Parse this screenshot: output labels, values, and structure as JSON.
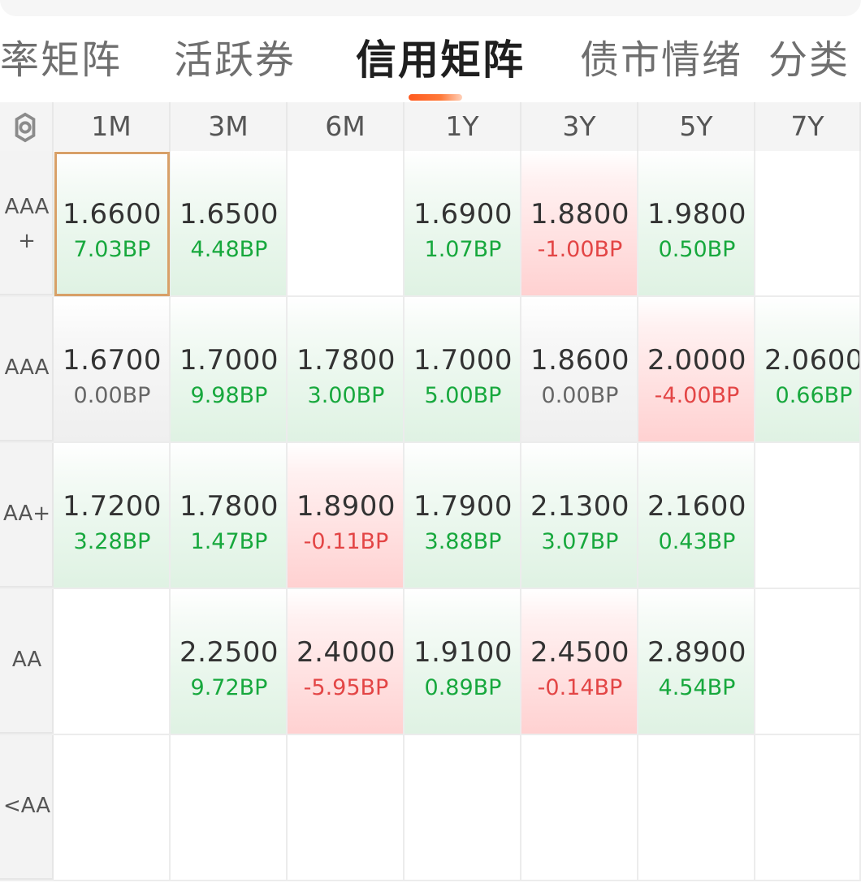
{
  "tabs": {
    "items": [
      {
        "label": "率矩阵"
      },
      {
        "label": "活跃券"
      },
      {
        "label": "信用矩阵"
      },
      {
        "label": "债市情绪"
      },
      {
        "label": "分类"
      }
    ],
    "active_index": 2
  },
  "matrix": {
    "columns": [
      "1M",
      "3M",
      "6M",
      "1Y",
      "3Y",
      "5Y",
      "7Y"
    ],
    "rows": [
      {
        "label": "AAA\n+",
        "cells": [
          {
            "value": "1.6600",
            "bp": "7.03BP",
            "tone": "green",
            "selected": true
          },
          {
            "value": "1.6500",
            "bp": "4.48BP",
            "tone": "green"
          },
          {
            "value": "",
            "bp": "",
            "tone": "empty"
          },
          {
            "value": "1.6900",
            "bp": "1.07BP",
            "tone": "green"
          },
          {
            "value": "1.8800",
            "bp": "-1.00BP",
            "tone": "red"
          },
          {
            "value": "1.9800",
            "bp": "0.50BP",
            "tone": "green"
          },
          {
            "value": "",
            "bp": "",
            "tone": "empty"
          }
        ]
      },
      {
        "label": "AAA",
        "cells": [
          {
            "value": "1.6700",
            "bp": "0.00BP",
            "tone": "gray"
          },
          {
            "value": "1.7000",
            "bp": "9.98BP",
            "tone": "green"
          },
          {
            "value": "1.7800",
            "bp": "3.00BP",
            "tone": "green"
          },
          {
            "value": "1.7000",
            "bp": "5.00BP",
            "tone": "green"
          },
          {
            "value": "1.8600",
            "bp": "0.00BP",
            "tone": "gray"
          },
          {
            "value": "2.0000",
            "bp": "-4.00BP",
            "tone": "red"
          },
          {
            "value": "2.0600",
            "bp": "0.66BP",
            "tone": "green"
          }
        ]
      },
      {
        "label": "AA+",
        "cells": [
          {
            "value": "1.7200",
            "bp": "3.28BP",
            "tone": "green"
          },
          {
            "value": "1.7800",
            "bp": "1.47BP",
            "tone": "green"
          },
          {
            "value": "1.8900",
            "bp": "-0.11BP",
            "tone": "red"
          },
          {
            "value": "1.7900",
            "bp": "3.88BP",
            "tone": "green"
          },
          {
            "value": "2.1300",
            "bp": "3.07BP",
            "tone": "green"
          },
          {
            "value": "2.1600",
            "bp": "0.43BP",
            "tone": "green"
          },
          {
            "value": "",
            "bp": "",
            "tone": "empty"
          }
        ]
      },
      {
        "label": "AA",
        "cells": [
          {
            "value": "",
            "bp": "",
            "tone": "empty"
          },
          {
            "value": "2.2500",
            "bp": "9.72BP",
            "tone": "green"
          },
          {
            "value": "2.4000",
            "bp": "-5.95BP",
            "tone": "red"
          },
          {
            "value": "1.9100",
            "bp": "0.89BP",
            "tone": "green"
          },
          {
            "value": "2.4500",
            "bp": "-0.14BP",
            "tone": "red"
          },
          {
            "value": "2.8900",
            "bp": "4.54BP",
            "tone": "green"
          },
          {
            "value": "",
            "bp": "",
            "tone": "empty"
          }
        ]
      },
      {
        "label": "<AA",
        "cells": [
          {
            "value": "",
            "bp": "",
            "tone": "empty"
          },
          {
            "value": "",
            "bp": "",
            "tone": "empty"
          },
          {
            "value": "",
            "bp": "",
            "tone": "empty"
          },
          {
            "value": "",
            "bp": "",
            "tone": "empty"
          },
          {
            "value": "",
            "bp": "",
            "tone": "empty"
          },
          {
            "value": "",
            "bp": "",
            "tone": "empty"
          },
          {
            "value": "",
            "bp": "",
            "tone": "empty"
          }
        ]
      }
    ]
  },
  "icons": {
    "settings": "gear-icon"
  },
  "colors": {
    "active_tab_text": "#1f1f1f",
    "inactive_tab_text": "#6f6f6f",
    "tab_underline": "#ff5a1f",
    "positive": "#17a83d",
    "negative": "#e34545",
    "neutral": "#666666",
    "selected_border": "#d8a068"
  }
}
